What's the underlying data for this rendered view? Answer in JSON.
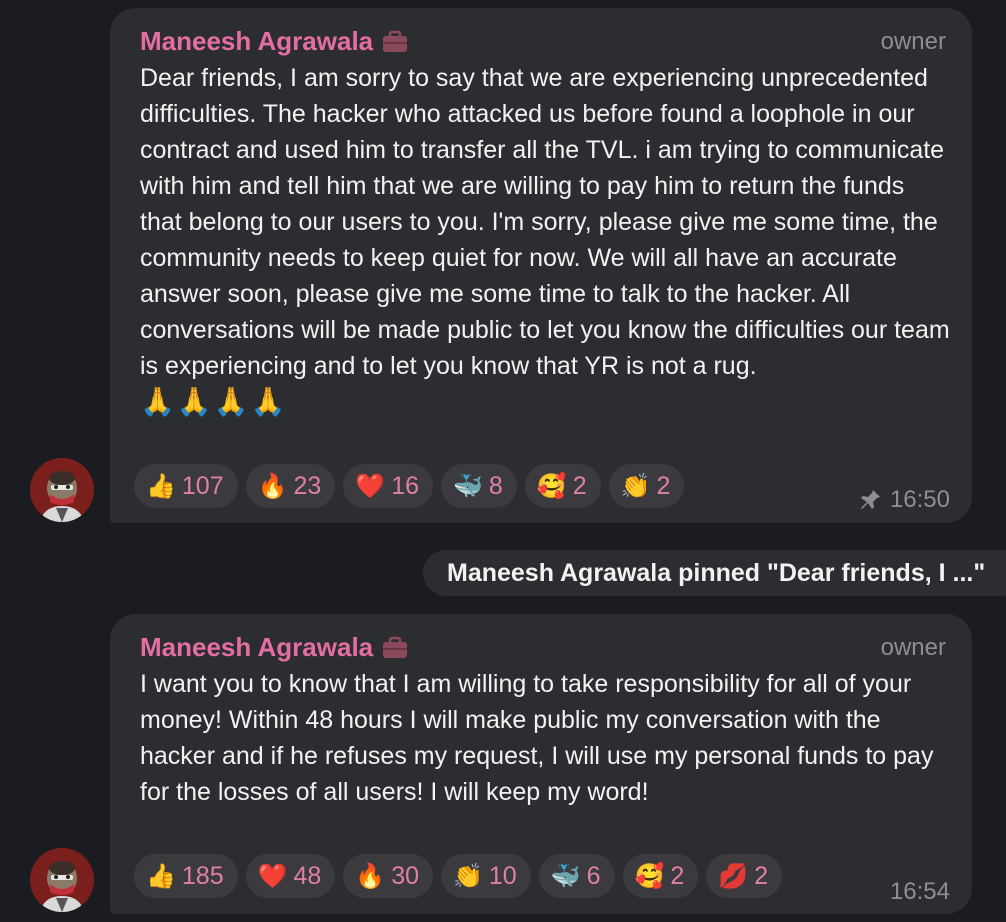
{
  "messages": [
    {
      "sender": "Maneesh Agrawala",
      "role": "owner",
      "text": "Dear friends, I am sorry to say that we are experiencing unprecedented difficulties. The hacker who attacked us before found a loophole in our contract and used him to transfer all the TVL. i am trying to communicate with him and tell him that we are willing to pay him to return the funds that belong to our users to you. I'm sorry, please give me some time, the community needs to keep quiet for now. We will all have an accurate answer soon, please give me some time to talk to the hacker. All conversations will be made public to let you know the difficulties our team is experiencing and to let you know that YR is not a rug.",
      "emoji_line": "🙏🙏🙏🙏",
      "reactions": [
        {
          "emoji": "👍",
          "count": "107"
        },
        {
          "emoji": "🔥",
          "count": "23"
        },
        {
          "emoji": "❤️",
          "count": "16"
        },
        {
          "emoji": "🐳",
          "count": "8"
        },
        {
          "emoji": "🥰",
          "count": "2"
        },
        {
          "emoji": "👏",
          "count": "2"
        }
      ],
      "time": "16:50",
      "pinned_icon": "pin-icon"
    },
    {
      "sender": "Maneesh Agrawala",
      "role": "owner",
      "text": "I want you to know that I am willing to take responsibility for all of your money! Within 48 hours I will make public my conversation with the hacker and if he refuses my request, I will use my personal funds to pay for the losses of all users! I will keep my word!",
      "reactions": [
        {
          "emoji": "👍",
          "count": "185"
        },
        {
          "emoji": "❤️",
          "count": "48"
        },
        {
          "emoji": "🔥",
          "count": "30"
        },
        {
          "emoji": "👏",
          "count": "10"
        },
        {
          "emoji": "🐳",
          "count": "6"
        },
        {
          "emoji": "🥰",
          "count": "2"
        },
        {
          "emoji": "💋",
          "count": "2"
        }
      ],
      "time": "16:54"
    }
  ],
  "service_message": "Maneesh Agrawala pinned \"Dear friends, I ...\"",
  "colors": {
    "background": "#1b1c21",
    "bubble": "#2c2d31",
    "sender": "#e46ea0",
    "reaction_count": "#e07fa8",
    "meta": "#8d8e93"
  }
}
